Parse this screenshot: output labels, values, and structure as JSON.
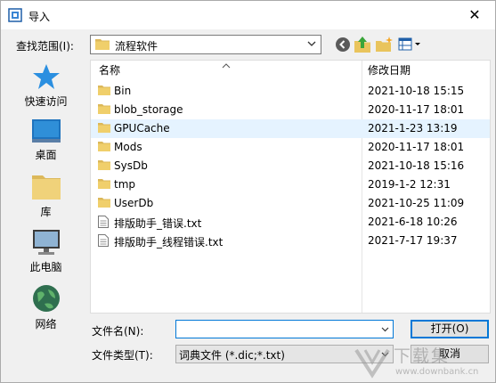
{
  "dialog": {
    "title": "导入",
    "close_glyph": "✕"
  },
  "lookin": {
    "label": "查找范围(I):",
    "value": "流程软件"
  },
  "places": [
    {
      "label": "快速访问",
      "icon": "quick-access-star-icon"
    },
    {
      "label": "桌面",
      "icon": "desktop-icon"
    },
    {
      "label": "库",
      "icon": "library-icon"
    },
    {
      "label": "此电脑",
      "icon": "this-pc-icon"
    },
    {
      "label": "网络",
      "icon": "network-icon"
    }
  ],
  "columns": {
    "name": "名称",
    "date": "修改日期"
  },
  "files": [
    {
      "name": "Bin",
      "date": "2021-10-18 15:15",
      "type": "folder"
    },
    {
      "name": "blob_storage",
      "date": "2020-11-17 18:01",
      "type": "folder"
    },
    {
      "name": "GPUCache",
      "date": "2021-1-23 13:19",
      "type": "folder"
    },
    {
      "name": "Mods",
      "date": "2020-11-17 18:01",
      "type": "folder"
    },
    {
      "name": "SysDb",
      "date": "2021-10-18 15:16",
      "type": "folder"
    },
    {
      "name": "tmp",
      "date": "2019-1-2 12:31",
      "type": "folder"
    },
    {
      "name": "UserDb",
      "date": "2021-10-25 11:09",
      "type": "folder"
    },
    {
      "name": "排版助手_错误.txt",
      "date": "2021-6-18 10:26",
      "type": "text-file"
    },
    {
      "name": "排版助手_线程错误.txt",
      "date": "2021-7-17 19:37",
      "type": "text-file"
    }
  ],
  "filename": {
    "label": "文件名(N):",
    "value": ""
  },
  "filetype": {
    "label": "文件类型(T):",
    "value": "词典文件 (*.dic;*.txt)"
  },
  "buttons": {
    "open": "打开(O)",
    "cancel": "取消"
  },
  "watermark": {
    "main": "下载集",
    "sub": "www.downbank.cn"
  },
  "colors": {
    "accent": "#0078d7",
    "hover_row": "#e5f3ff",
    "folder": "#dcb85a"
  }
}
